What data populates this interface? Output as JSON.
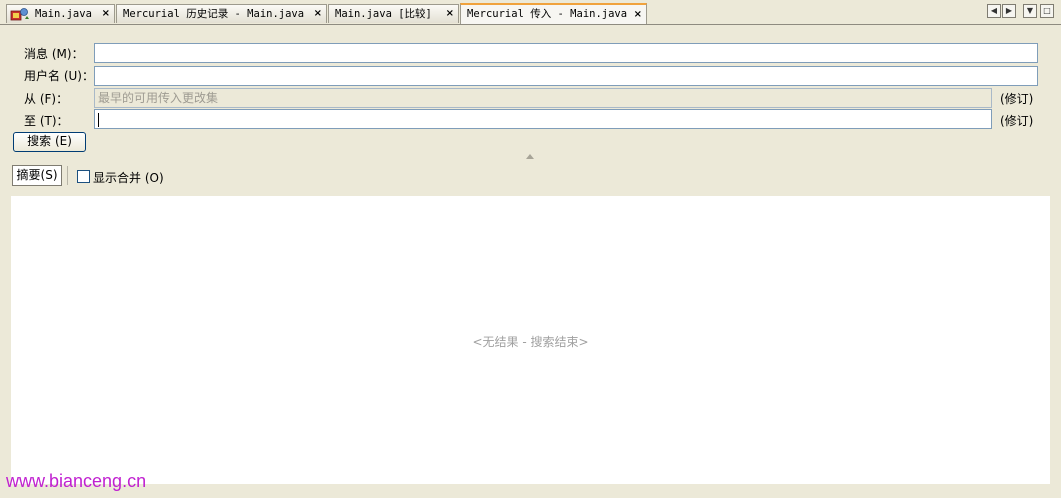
{
  "tabs": [
    {
      "label": "Main.java",
      "active": false
    },
    {
      "label": "Mercurial 历史记录 - Main.java",
      "active": false
    },
    {
      "label": "Main.java [比较]",
      "active": false
    },
    {
      "label": "Mercurial 传入 - Main.java",
      "active": true
    }
  ],
  "tab_close_glyph": "×",
  "nav": {
    "left": "◀",
    "right": "▶",
    "menu": "▼",
    "maximize": "□"
  },
  "form": {
    "message_label": "消息",
    "message_mnemonic": "(M)",
    "message_value": "",
    "username_label": "用户名",
    "username_mnemonic": "(U)",
    "username_value": "",
    "from_label": "从",
    "from_mnemonic": "(F)",
    "from_placeholder": "最早的可用传入更改集",
    "to_label": "至",
    "to_mnemonic": "(T)",
    "to_value": "",
    "revision_suffix": "(修订)",
    "colon": "："
  },
  "search_button": {
    "label": "搜索",
    "mnemonic": "(E)"
  },
  "toolbar": {
    "summary_label": "摘要",
    "summary_mnemonic": "(S)",
    "show_merges_label": "显示合并",
    "show_merges_mnemonic": "(O)",
    "show_merges_checked": false
  },
  "results": {
    "empty_message": "<无结果 - 搜索结束>"
  },
  "watermark": "www.bianceng.cn",
  "colors": {
    "active_tab_accent": "#f0a23c",
    "input_border": "#7f9db9",
    "watermark": "#c020d0"
  }
}
